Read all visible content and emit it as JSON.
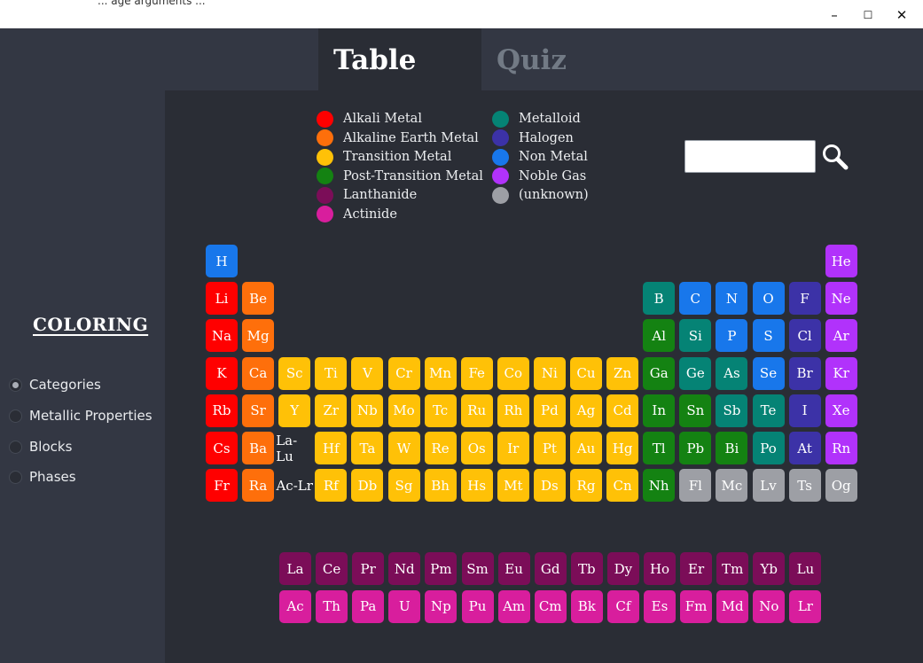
{
  "titlebar": {
    "fragment_text": "... age arguments ...",
    "minimize_icon": "–",
    "maximize_icon": "☐",
    "close_icon": "✕"
  },
  "tabs": [
    {
      "label": "Table",
      "active": true
    },
    {
      "label": "Quiz",
      "active": false
    }
  ],
  "sidebar": {
    "heading": "COLORING",
    "options": [
      {
        "label": "Categories",
        "selected": true
      },
      {
        "label": "Metallic Properties",
        "selected": false
      },
      {
        "label": "Blocks",
        "selected": false
      },
      {
        "label": "Phases",
        "selected": false
      }
    ]
  },
  "legend": {
    "col1": [
      {
        "label": "Alkali Metal",
        "color": "#ff0000"
      },
      {
        "label": "Alkaline Earth Metal",
        "color": "#fe6f0b"
      },
      {
        "label": "Transition Metal",
        "color": "#ffc107"
      },
      {
        "label": "Post-Transition Metal",
        "color": "#148212"
      },
      {
        "label": "Lanthanide",
        "color": "#7b0d58"
      },
      {
        "label": "Actinide",
        "color": "#d81e9d"
      }
    ],
    "col2": [
      {
        "label": "Metalloid",
        "color": "#058375"
      },
      {
        "label": "Halogen",
        "color": "#3c32a7"
      },
      {
        "label": "Non Metal",
        "color": "#1877eb"
      },
      {
        "label": "Noble Gas",
        "color": "#b132fb"
      },
      {
        "label": "(unknown)",
        "color": "#9d9fa5"
      }
    ]
  },
  "search": {
    "placeholder": "",
    "value": "",
    "icon": "magnifier-icon"
  },
  "category_colors": {
    "am": "#ff0000",
    "ae": "#fe6f0b",
    "tm": "#ffc107",
    "pt": "#148212",
    "la": "#7b0d58",
    "ac": "#d81e9d",
    "md": "#058375",
    "ha": "#3c32a7",
    "nm": "#1877eb",
    "ng": "#b132fb",
    "uk": "#9d9fa5"
  },
  "elements": [
    {
      "s": "H",
      "c": "nm",
      "r": 0,
      "g": 0
    },
    {
      "s": "He",
      "c": "ng",
      "r": 0,
      "g": 17
    },
    {
      "s": "Li",
      "c": "am",
      "r": 1,
      "g": 0
    },
    {
      "s": "Be",
      "c": "ae",
      "r": 1,
      "g": 1
    },
    {
      "s": "B",
      "c": "md",
      "r": 1,
      "g": 12
    },
    {
      "s": "C",
      "c": "nm",
      "r": 1,
      "g": 13
    },
    {
      "s": "N",
      "c": "nm",
      "r": 1,
      "g": 14
    },
    {
      "s": "O",
      "c": "nm",
      "r": 1,
      "g": 15
    },
    {
      "s": "F",
      "c": "ha",
      "r": 1,
      "g": 16
    },
    {
      "s": "Ne",
      "c": "ng",
      "r": 1,
      "g": 17
    },
    {
      "s": "Na",
      "c": "am",
      "r": 2,
      "g": 0
    },
    {
      "s": "Mg",
      "c": "ae",
      "r": 2,
      "g": 1
    },
    {
      "s": "Al",
      "c": "pt",
      "r": 2,
      "g": 12
    },
    {
      "s": "Si",
      "c": "md",
      "r": 2,
      "g": 13
    },
    {
      "s": "P",
      "c": "nm",
      "r": 2,
      "g": 14
    },
    {
      "s": "S",
      "c": "nm",
      "r": 2,
      "g": 15
    },
    {
      "s": "Cl",
      "c": "ha",
      "r": 2,
      "g": 16
    },
    {
      "s": "Ar",
      "c": "ng",
      "r": 2,
      "g": 17
    },
    {
      "s": "K",
      "c": "am",
      "r": 3,
      "g": 0
    },
    {
      "s": "Ca",
      "c": "ae",
      "r": 3,
      "g": 1
    },
    {
      "s": "Sc",
      "c": "tm",
      "r": 3,
      "g": 2
    },
    {
      "s": "Ti",
      "c": "tm",
      "r": 3,
      "g": 3
    },
    {
      "s": "V",
      "c": "tm",
      "r": 3,
      "g": 4
    },
    {
      "s": "Cr",
      "c": "tm",
      "r": 3,
      "g": 5
    },
    {
      "s": "Mn",
      "c": "tm",
      "r": 3,
      "g": 6
    },
    {
      "s": "Fe",
      "c": "tm",
      "r": 3,
      "g": 7
    },
    {
      "s": "Co",
      "c": "tm",
      "r": 3,
      "g": 8
    },
    {
      "s": "Ni",
      "c": "tm",
      "r": 3,
      "g": 9
    },
    {
      "s": "Cu",
      "c": "tm",
      "r": 3,
      "g": 10
    },
    {
      "s": "Zn",
      "c": "tm",
      "r": 3,
      "g": 11
    },
    {
      "s": "Ga",
      "c": "pt",
      "r": 3,
      "g": 12
    },
    {
      "s": "Ge",
      "c": "md",
      "r": 3,
      "g": 13
    },
    {
      "s": "As",
      "c": "md",
      "r": 3,
      "g": 14
    },
    {
      "s": "Se",
      "c": "nm",
      "r": 3,
      "g": 15
    },
    {
      "s": "Br",
      "c": "ha",
      "r": 3,
      "g": 16
    },
    {
      "s": "Kr",
      "c": "ng",
      "r": 3,
      "g": 17
    },
    {
      "s": "Rb",
      "c": "am",
      "r": 4,
      "g": 0
    },
    {
      "s": "Sr",
      "c": "ae",
      "r": 4,
      "g": 1
    },
    {
      "s": "Y",
      "c": "tm",
      "r": 4,
      "g": 2
    },
    {
      "s": "Zr",
      "c": "tm",
      "r": 4,
      "g": 3
    },
    {
      "s": "Nb",
      "c": "tm",
      "r": 4,
      "g": 4
    },
    {
      "s": "Mo",
      "c": "tm",
      "r": 4,
      "g": 5
    },
    {
      "s": "Tc",
      "c": "tm",
      "r": 4,
      "g": 6
    },
    {
      "s": "Ru",
      "c": "tm",
      "r": 4,
      "g": 7
    },
    {
      "s": "Rh",
      "c": "tm",
      "r": 4,
      "g": 8
    },
    {
      "s": "Pd",
      "c": "tm",
      "r": 4,
      "g": 9
    },
    {
      "s": "Ag",
      "c": "tm",
      "r": 4,
      "g": 10
    },
    {
      "s": "Cd",
      "c": "tm",
      "r": 4,
      "g": 11
    },
    {
      "s": "In",
      "c": "pt",
      "r": 4,
      "g": 12
    },
    {
      "s": "Sn",
      "c": "pt",
      "r": 4,
      "g": 13
    },
    {
      "s": "Sb",
      "c": "md",
      "r": 4,
      "g": 14
    },
    {
      "s": "Te",
      "c": "md",
      "r": 4,
      "g": 15
    },
    {
      "s": "I",
      "c": "ha",
      "r": 4,
      "g": 16
    },
    {
      "s": "Xe",
      "c": "ng",
      "r": 4,
      "g": 17
    },
    {
      "s": "Cs",
      "c": "am",
      "r": 5,
      "g": 0
    },
    {
      "s": "Ba",
      "c": "ae",
      "r": 5,
      "g": 1
    },
    {
      "s": "Hf",
      "c": "tm",
      "r": 5,
      "g": 3
    },
    {
      "s": "Ta",
      "c": "tm",
      "r": 5,
      "g": 4
    },
    {
      "s": "W",
      "c": "tm",
      "r": 5,
      "g": 5
    },
    {
      "s": "Re",
      "c": "tm",
      "r": 5,
      "g": 6
    },
    {
      "s": "Os",
      "c": "tm",
      "r": 5,
      "g": 7
    },
    {
      "s": "Ir",
      "c": "tm",
      "r": 5,
      "g": 8
    },
    {
      "s": "Pt",
      "c": "tm",
      "r": 5,
      "g": 9
    },
    {
      "s": "Au",
      "c": "tm",
      "r": 5,
      "g": 10
    },
    {
      "s": "Hg",
      "c": "tm",
      "r": 5,
      "g": 11
    },
    {
      "s": "Tl",
      "c": "pt",
      "r": 5,
      "g": 12
    },
    {
      "s": "Pb",
      "c": "pt",
      "r": 5,
      "g": 13
    },
    {
      "s": "Bi",
      "c": "pt",
      "r": 5,
      "g": 14
    },
    {
      "s": "Po",
      "c": "md",
      "r": 5,
      "g": 15
    },
    {
      "s": "At",
      "c": "ha",
      "r": 5,
      "g": 16
    },
    {
      "s": "Rn",
      "c": "ng",
      "r": 5,
      "g": 17
    },
    {
      "s": "Fr",
      "c": "am",
      "r": 6,
      "g": 0
    },
    {
      "s": "Ra",
      "c": "ae",
      "r": 6,
      "g": 1
    },
    {
      "s": "Rf",
      "c": "tm",
      "r": 6,
      "g": 3
    },
    {
      "s": "Db",
      "c": "tm",
      "r": 6,
      "g": 4
    },
    {
      "s": "Sg",
      "c": "tm",
      "r": 6,
      "g": 5
    },
    {
      "s": "Bh",
      "c": "tm",
      "r": 6,
      "g": 6
    },
    {
      "s": "Hs",
      "c": "tm",
      "r": 6,
      "g": 7
    },
    {
      "s": "Mt",
      "c": "tm",
      "r": 6,
      "g": 8
    },
    {
      "s": "Ds",
      "c": "tm",
      "r": 6,
      "g": 9
    },
    {
      "s": "Rg",
      "c": "tm",
      "r": 6,
      "g": 10
    },
    {
      "s": "Cn",
      "c": "tm",
      "r": 6,
      "g": 11
    },
    {
      "s": "Nh",
      "c": "pt",
      "r": 6,
      "g": 12
    },
    {
      "s": "Fl",
      "c": "uk",
      "r": 6,
      "g": 13
    },
    {
      "s": "Mc",
      "c": "uk",
      "r": 6,
      "g": 14
    },
    {
      "s": "Lv",
      "c": "uk",
      "r": 6,
      "g": 15
    },
    {
      "s": "Ts",
      "c": "uk",
      "r": 6,
      "g": 16
    },
    {
      "s": "Og",
      "c": "uk",
      "r": 6,
      "g": 17
    }
  ],
  "placeholders": [
    {
      "label": "La-Lu",
      "r": 5,
      "g": 2
    },
    {
      "label": "Ac-Lr",
      "r": 6,
      "g": 2
    }
  ],
  "f_block": [
    {
      "s": "La",
      "c": "la",
      "r": 0,
      "i": 0
    },
    {
      "s": "Ce",
      "c": "la",
      "r": 0,
      "i": 1
    },
    {
      "s": "Pr",
      "c": "la",
      "r": 0,
      "i": 2
    },
    {
      "s": "Nd",
      "c": "la",
      "r": 0,
      "i": 3
    },
    {
      "s": "Pm",
      "c": "la",
      "r": 0,
      "i": 4
    },
    {
      "s": "Sm",
      "c": "la",
      "r": 0,
      "i": 5
    },
    {
      "s": "Eu",
      "c": "la",
      "r": 0,
      "i": 6
    },
    {
      "s": "Gd",
      "c": "la",
      "r": 0,
      "i": 7
    },
    {
      "s": "Tb",
      "c": "la",
      "r": 0,
      "i": 8
    },
    {
      "s": "Dy",
      "c": "la",
      "r": 0,
      "i": 9
    },
    {
      "s": "Ho",
      "c": "la",
      "r": 0,
      "i": 10
    },
    {
      "s": "Er",
      "c": "la",
      "r": 0,
      "i": 11
    },
    {
      "s": "Tm",
      "c": "la",
      "r": 0,
      "i": 12
    },
    {
      "s": "Yb",
      "c": "la",
      "r": 0,
      "i": 13
    },
    {
      "s": "Lu",
      "c": "la",
      "r": 0,
      "i": 14
    },
    {
      "s": "Ac",
      "c": "ac",
      "r": 1,
      "i": 0
    },
    {
      "s": "Th",
      "c": "ac",
      "r": 1,
      "i": 1
    },
    {
      "s": "Pa",
      "c": "ac",
      "r": 1,
      "i": 2
    },
    {
      "s": "U",
      "c": "ac",
      "r": 1,
      "i": 3
    },
    {
      "s": "Np",
      "c": "ac",
      "r": 1,
      "i": 4
    },
    {
      "s": "Pu",
      "c": "ac",
      "r": 1,
      "i": 5
    },
    {
      "s": "Am",
      "c": "ac",
      "r": 1,
      "i": 6
    },
    {
      "s": "Cm",
      "c": "ac",
      "r": 1,
      "i": 7
    },
    {
      "s": "Bk",
      "c": "ac",
      "r": 1,
      "i": 8
    },
    {
      "s": "Cf",
      "c": "ac",
      "r": 1,
      "i": 9
    },
    {
      "s": "Es",
      "c": "ac",
      "r": 1,
      "i": 10
    },
    {
      "s": "Fm",
      "c": "ac",
      "r": 1,
      "i": 11
    },
    {
      "s": "Md",
      "c": "ac",
      "r": 1,
      "i": 12
    },
    {
      "s": "No",
      "c": "ac",
      "r": 1,
      "i": 13
    },
    {
      "s": "Lr",
      "c": "ac",
      "r": 1,
      "i": 14
    }
  ]
}
